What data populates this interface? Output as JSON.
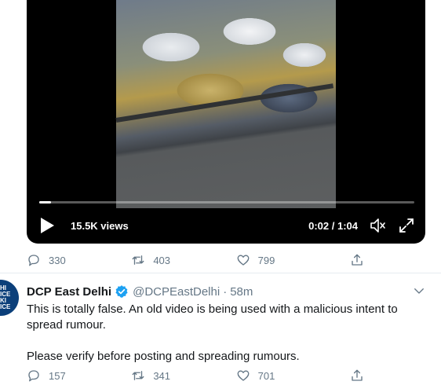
{
  "video": {
    "views": "15.5K views",
    "time": "0:02 / 1:04",
    "progress_fraction": 0.032
  },
  "tweet1": {
    "actions": {
      "reply_count": "330",
      "retweet_count": "403",
      "like_count": "799"
    }
  },
  "tweet2": {
    "avatar_text": [
      "HI",
      "ICE",
      "KI",
      "ICE"
    ],
    "author": "DCP East Delhi",
    "handle": "@DCPEastDelhi",
    "separator": "·",
    "time_ago": "58m",
    "text_line1": "This is totally false. An old video is being used with a malicious intent to spread rumour.",
    "text_line2": "Please verify before posting and spreading rumours.",
    "actions": {
      "reply_count": "157",
      "retweet_count": "341",
      "like_count": "701"
    }
  },
  "colors": {
    "text_primary": "#14171a",
    "text_secondary": "#657786",
    "verified_blue": "#1da1f2",
    "divider": "#e6ecf0",
    "avatar_bg": "#0b3f7a"
  },
  "icons": {
    "play": "play-icon",
    "volume": "volume-icon",
    "fullscreen": "fullscreen-icon",
    "reply": "reply-icon",
    "retweet": "retweet-icon",
    "like": "like-icon",
    "share": "share-icon",
    "verified": "verified-icon",
    "caret": "chevron-down-icon"
  }
}
